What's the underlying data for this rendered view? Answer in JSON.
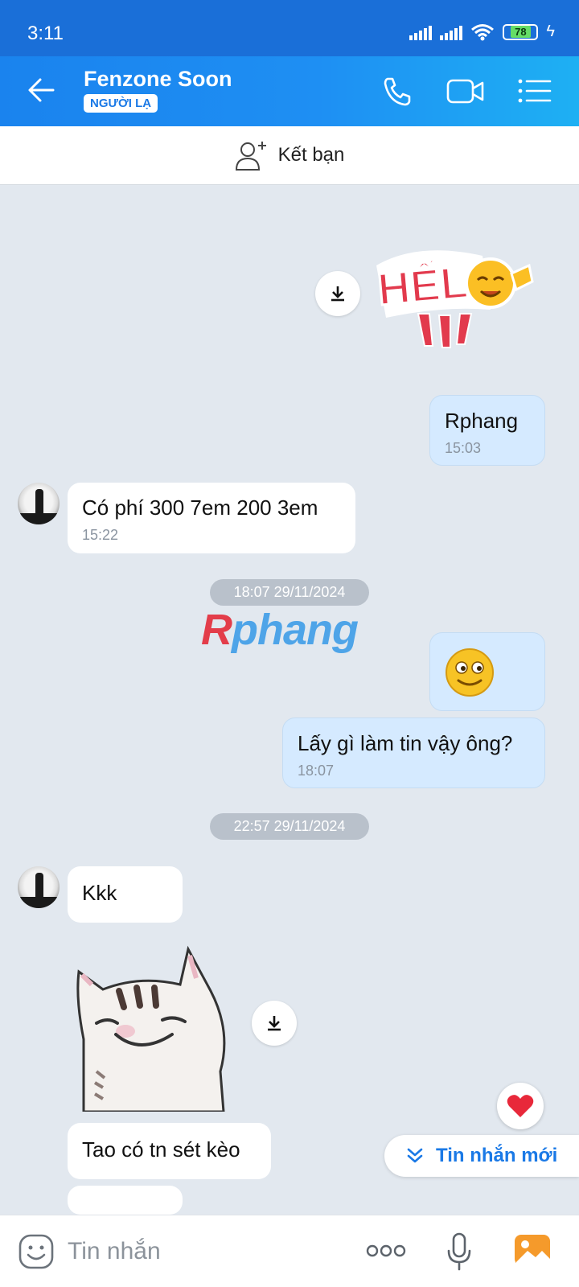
{
  "status": {
    "time": "3:11",
    "battery": "78"
  },
  "header": {
    "name": "Fenzone Soon",
    "tag": "NGƯỜI LẠ"
  },
  "add_friend": {
    "label": "Kết bạn"
  },
  "messages": {
    "m1": {
      "text": "Rphang",
      "time": "15:03"
    },
    "m2": {
      "text": "Có phí 300 7em 200 3em",
      "time": "15:22"
    },
    "date1": "18:07 29/11/2024",
    "m4": {
      "text": "Lấy gì làm tin vậy ông?",
      "time": "18:07"
    },
    "date2": "22:57 29/11/2024",
    "m5": {
      "text": "Kkk"
    },
    "m7": {
      "text": "Tao có tn sét kèo"
    }
  },
  "watermark": {
    "part1": "R",
    "part2": "phang"
  },
  "sticker_hello": {
    "text": "HẾL"
  },
  "new_messages": {
    "label": "Tin nhắn mới"
  },
  "composer": {
    "placeholder": "Tin nhắn"
  },
  "colors": {
    "header": "#1e8ff3",
    "bubble_out": "#d5eaff",
    "accent": "#1a79e6"
  }
}
